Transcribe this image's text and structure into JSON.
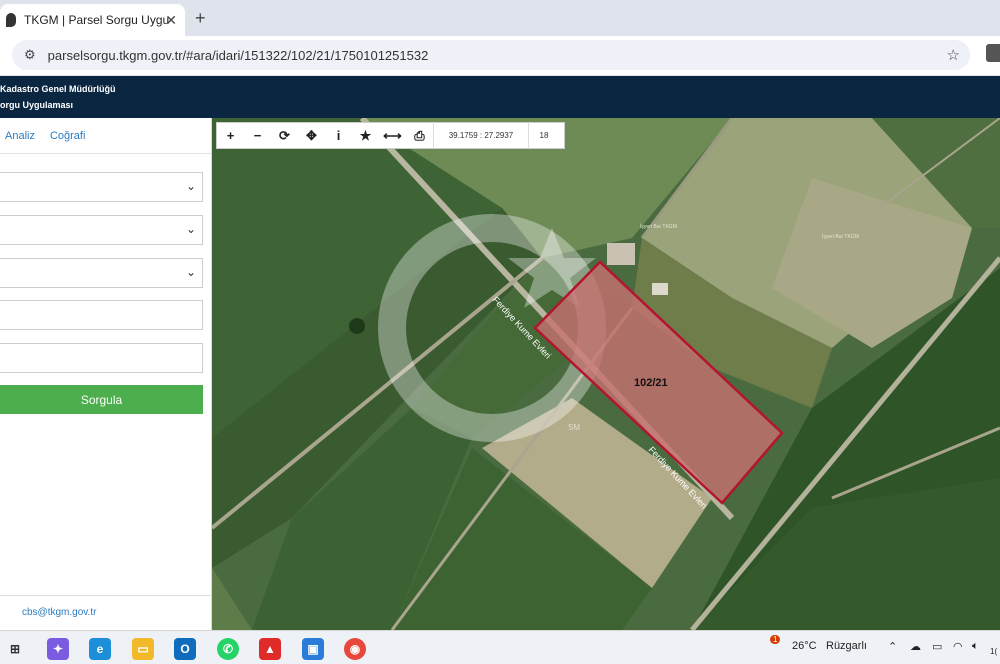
{
  "browser": {
    "tab_title": "TKGM | Parsel Sorgu Uygulaması",
    "tab_close": "✕",
    "new_tab": "+",
    "url": "parselsorgu.tkgm.gov.tr/#ara/idari/151322/102/21/1750101251532"
  },
  "header": {
    "line1": "Kadastro Genel Müdürlüğü",
    "line2": "orgu Uygulaması"
  },
  "panel": {
    "tabs": [
      "Analiz",
      "Coğrafi"
    ],
    "submit_label": "Sorgula",
    "email": "cbs@tkgm.gov.tr"
  },
  "map": {
    "coordinates": "39.1759 : 27.2937",
    "zoom": "18",
    "parcel_label": "102/21",
    "road_label_1": "Ferdiye Kume Evleri",
    "road_label_2": "Ferdiye Kume Evleri",
    "field_label_1": "İşyeri Bur TKGM",
    "field_label_2": "İşyeri Bur TKGM",
    "watermark_sm": "SM",
    "parcel_color": "#b3152f"
  },
  "taskbar": {
    "temperature": "26°C",
    "weather": "Rüzgarlı",
    "notification_count": "1",
    "clock": "1("
  }
}
